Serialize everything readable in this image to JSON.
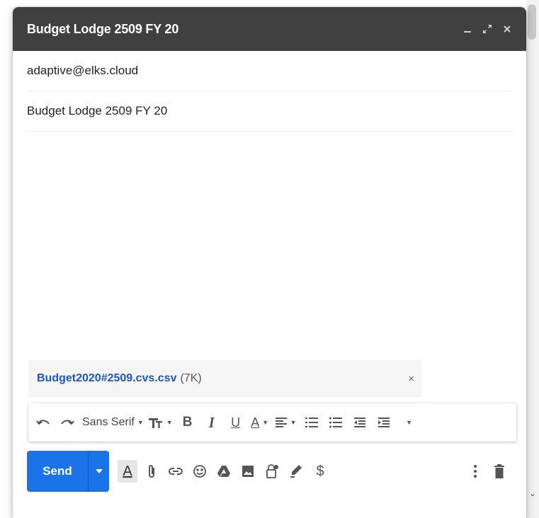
{
  "window": {
    "title": "Budget Lodge 2509 FY 20",
    "minimize_icon": "minimize-icon",
    "expand_icon": "expand-icon",
    "close_icon": "close-icon"
  },
  "compose": {
    "to": "adaptive@elks.cloud",
    "subject": "Budget Lodge 2509 FY 20",
    "body": ""
  },
  "attachment": {
    "name": "Budget2020#2509.cvs.csv",
    "size": "(7K)",
    "remove_label": "×"
  },
  "format_bar": {
    "font": "Sans Serif",
    "bold": "B",
    "italic": "I",
    "underline": "U",
    "text_color": "A"
  },
  "bottom_bar": {
    "send_label": "Send",
    "formatting_label": "A",
    "dollar_label": "$"
  },
  "colors": {
    "titlebar": "#404040",
    "send": "#1a73e8",
    "attachment_link": "#1a56c9"
  }
}
